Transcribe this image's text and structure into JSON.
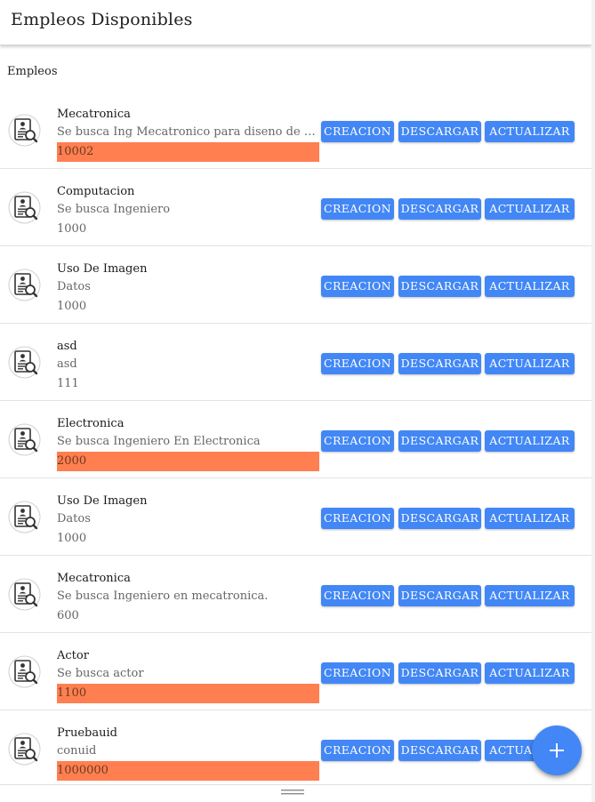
{
  "header": {
    "title": "Empleos Disponibles"
  },
  "section": {
    "label": "Empleos"
  },
  "buttons": {
    "creacion": "CREACION",
    "descargar": "DESCARGAR",
    "actualizar": "ACTUALIZAR"
  },
  "accent_color": "#4287f5",
  "highlight_color": "#ff7f50",
  "avatar_icon": "job-search-document-icon",
  "fab_icon": "plus-icon",
  "jobs": [
    {
      "title": "Mecatronica",
      "description": "Se busca Ing Mecatronico para diseno de casa automatizada",
      "salary": "10002",
      "highlighted": true
    },
    {
      "title": "Computacion",
      "description": "Se busca Ingeniero",
      "salary": "1000",
      "highlighted": false
    },
    {
      "title": "Uso De Imagen",
      "description": "Datos",
      "salary": "1000",
      "highlighted": false
    },
    {
      "title": "asd",
      "description": "asd",
      "salary": "111",
      "highlighted": false
    },
    {
      "title": "Electronica",
      "description": "Se busca Ingeniero En Electronica",
      "salary": "2000",
      "highlighted": true
    },
    {
      "title": "Uso De Imagen",
      "description": "Datos",
      "salary": "1000",
      "highlighted": false
    },
    {
      "title": "Mecatronica",
      "description": "Se busca Ingeniero en mecatronica.",
      "salary": "600",
      "highlighted": false
    },
    {
      "title": "Actor",
      "description": "Se busca actor",
      "salary": "1100",
      "highlighted": true
    },
    {
      "title": "Pruebauid",
      "description": "conuid",
      "salary": "1000000",
      "highlighted": true
    }
  ]
}
